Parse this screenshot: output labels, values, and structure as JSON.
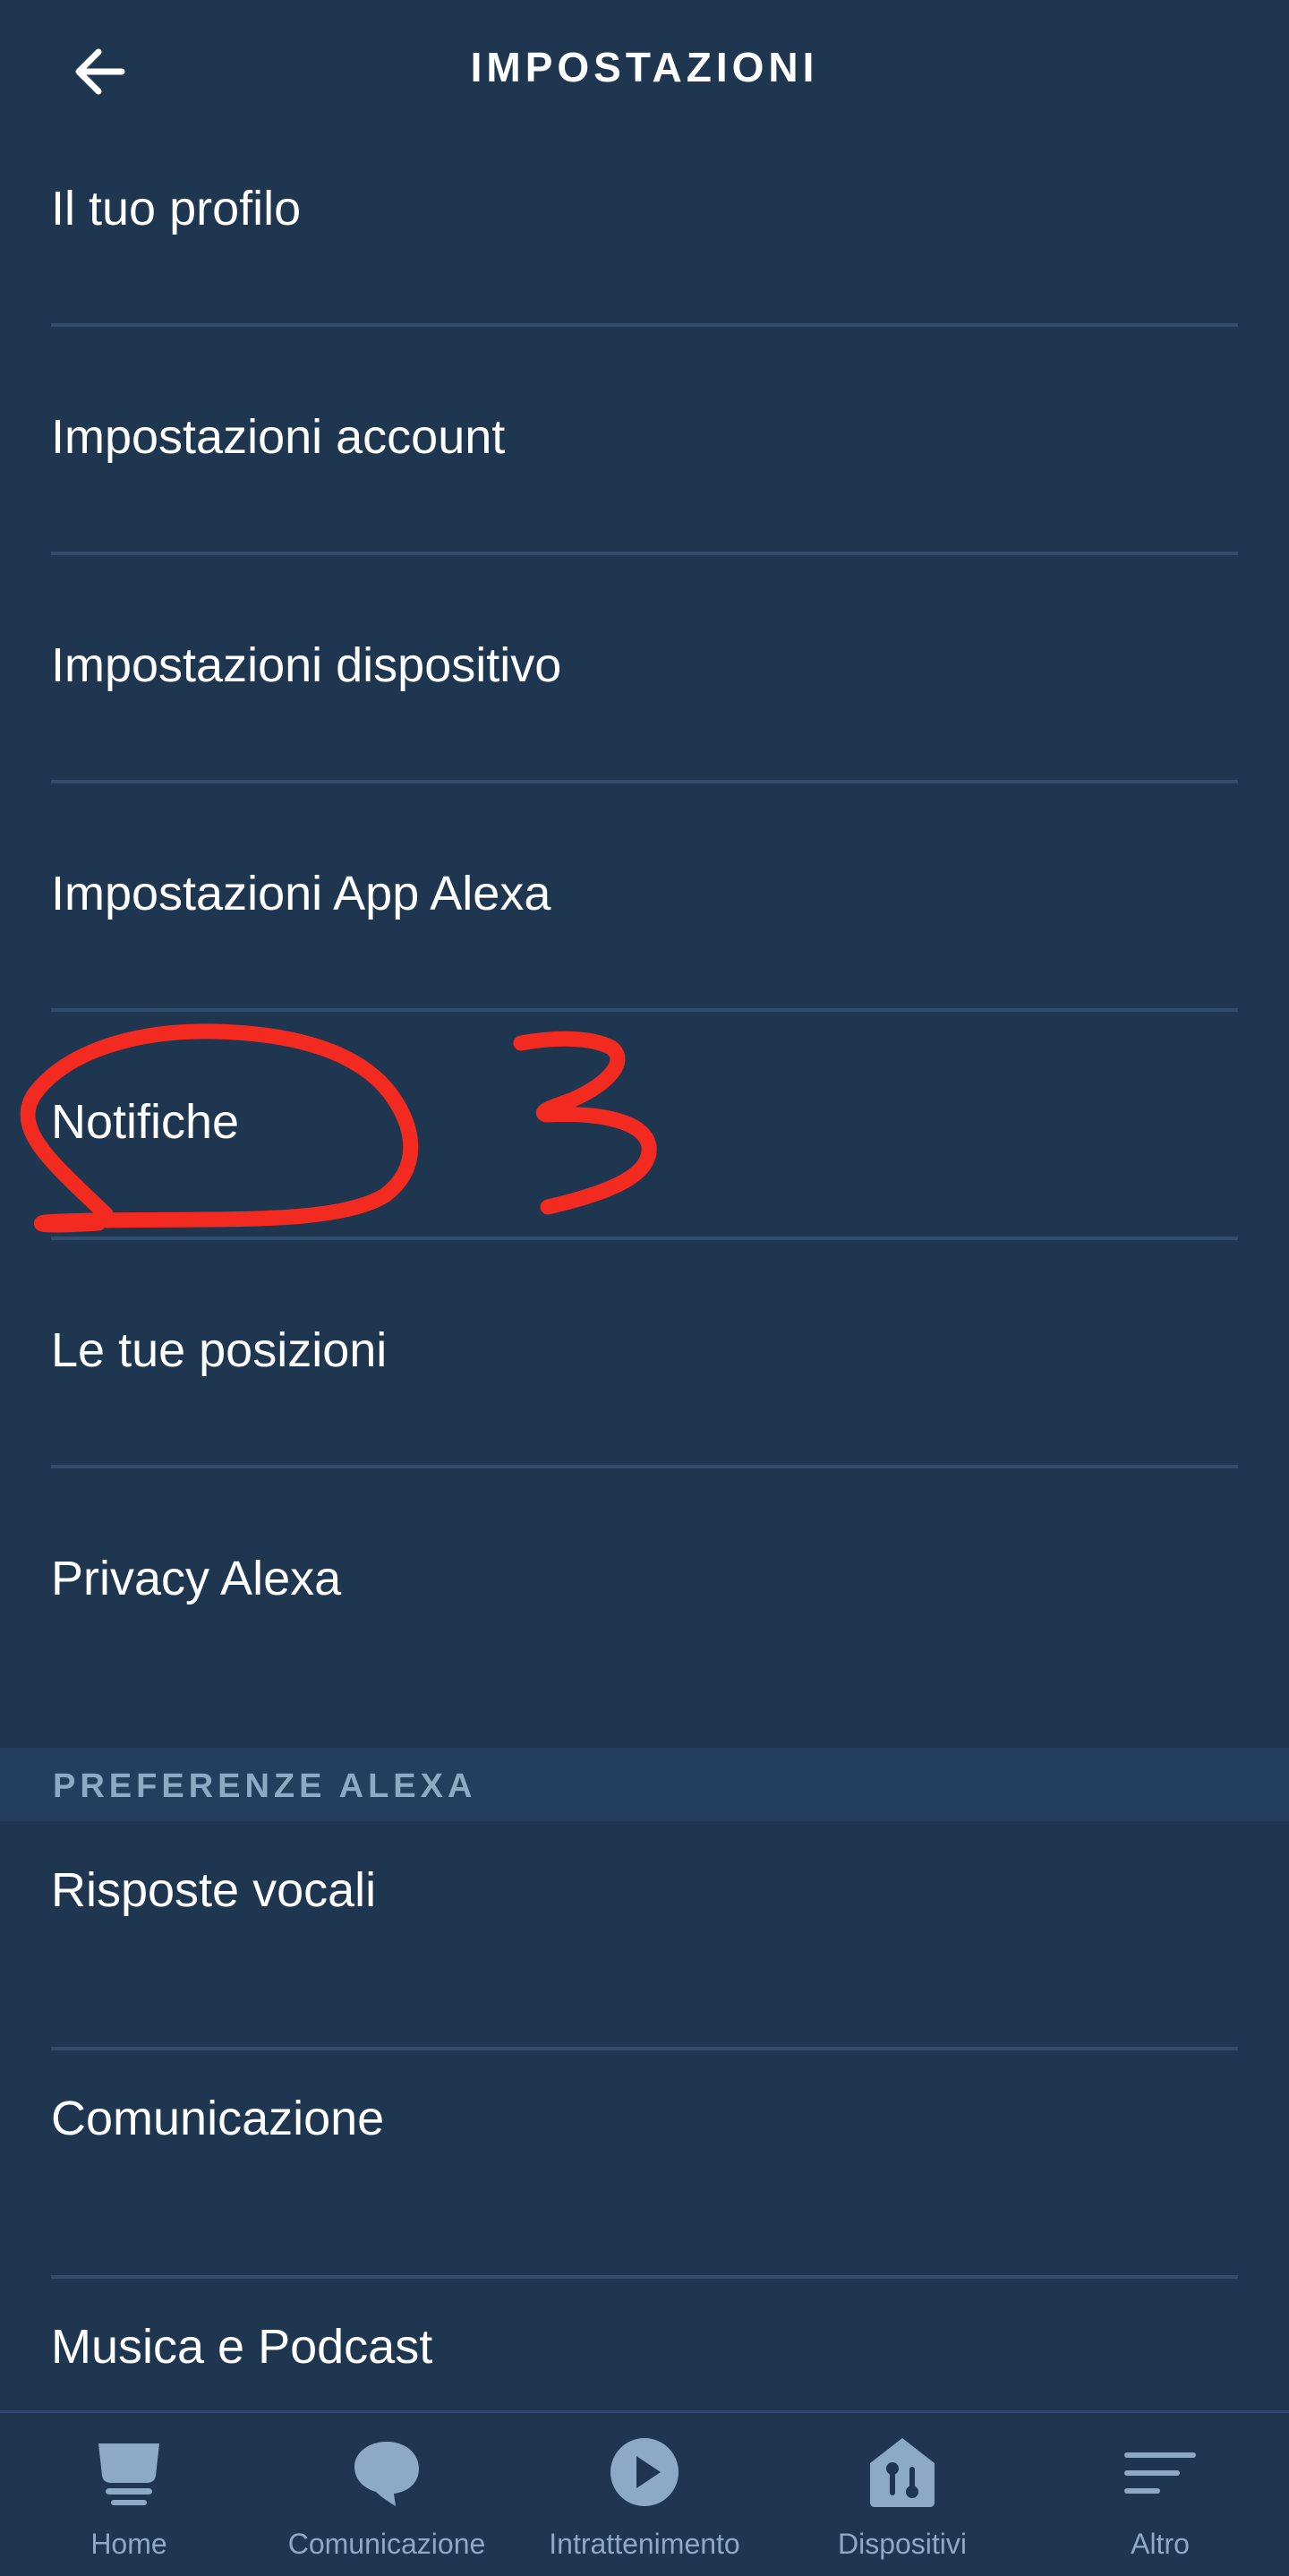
{
  "header": {
    "title": "IMPOSTAZIONI"
  },
  "settings": {
    "items": [
      {
        "label": "Il tuo profilo"
      },
      {
        "label": "Impostazioni account"
      },
      {
        "label": "Impostazioni dispositivo"
      },
      {
        "label": "Impostazioni App Alexa"
      },
      {
        "label": "Notifiche"
      },
      {
        "label": "Le tue posizioni"
      },
      {
        "label": "Privacy Alexa"
      }
    ]
  },
  "section": {
    "label": "PREFERENZE ALEXA",
    "items": [
      {
        "label": "Risposte vocali"
      },
      {
        "label": "Comunicazione"
      },
      {
        "label": "Musica e Podcast"
      }
    ]
  },
  "bottom_nav": {
    "items": [
      {
        "label": "Home",
        "icon": "home-icon"
      },
      {
        "label": "Comunicazione",
        "icon": "chat-bubble-icon"
      },
      {
        "label": "Intrattenimento",
        "icon": "play-icon"
      },
      {
        "label": "Dispositivi",
        "icon": "devices-house-icon"
      },
      {
        "label": "Altro",
        "icon": "menu-lines-icon"
      }
    ]
  },
  "annotation": {
    "number": "3",
    "color": "#f22a20"
  },
  "colors": {
    "background": "#1f3651",
    "divider": "#324d6c",
    "section_background": "#243f5e",
    "muted_text": "#8ea9c4"
  }
}
